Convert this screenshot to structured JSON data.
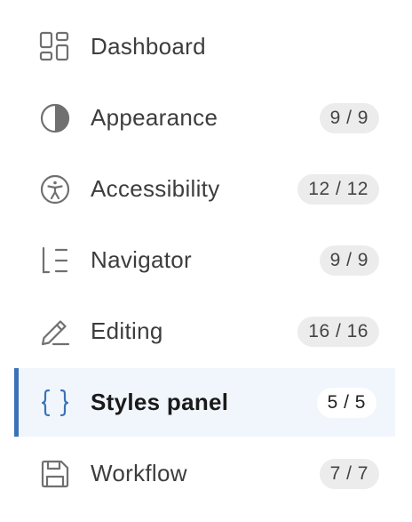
{
  "nav": {
    "items": [
      {
        "label": "Dashboard",
        "badge": "",
        "icon": "dashboard-grid-icon",
        "selected": false
      },
      {
        "label": "Appearance",
        "badge": "9 / 9",
        "icon": "half-circle-contrast-icon",
        "selected": false
      },
      {
        "label": "Accessibility",
        "badge": "12 / 12",
        "icon": "accessibility-person-icon",
        "selected": false
      },
      {
        "label": "Navigator",
        "badge": "9 / 9",
        "icon": "navigator-tree-icon",
        "selected": false
      },
      {
        "label": "Editing",
        "badge": "16 / 16",
        "icon": "pencil-icon",
        "selected": false
      },
      {
        "label": "Styles panel",
        "badge": "5 / 5",
        "icon": "curly-braces-icon",
        "selected": true
      },
      {
        "label": "Workflow",
        "badge": "7 / 7",
        "icon": "save-floppy-icon",
        "selected": false
      }
    ]
  },
  "colors": {
    "accent": "#3a72b8",
    "selected_background": "#f1f6fc",
    "badge_background": "#ececec",
    "icon_gray": "#707070"
  }
}
